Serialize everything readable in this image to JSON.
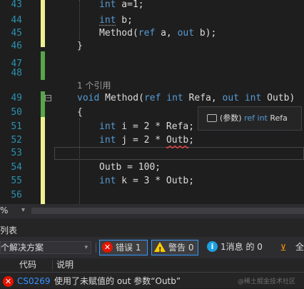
{
  "editor": {
    "lines": [
      {
        "num": "43"
      },
      {
        "num": "44"
      },
      {
        "num": "45"
      },
      {
        "num": "46"
      },
      {
        "num": "47"
      },
      {
        "num": "48"
      },
      {
        "num": "49"
      },
      {
        "num": "50"
      },
      {
        "num": "51"
      },
      {
        "num": "52"
      },
      {
        "num": "53"
      },
      {
        "num": "54"
      },
      {
        "num": "55"
      },
      {
        "num": "56"
      }
    ],
    "code": {
      "l43_kw": "int",
      "l43_rest": " a=1;",
      "l44_kw": "int",
      "l44_rest": " b;",
      "l45_a": "Method(",
      "l45_ref": "ref",
      "l45_b": " a, ",
      "l45_out": "out",
      "l45_c": " b);",
      "l46": "}",
      "l49_void": "void",
      "l49_a": " Method(",
      "l49_ref": "ref",
      "l49_int1": "int",
      "l49_b": " Refa, ",
      "l49_out": "out",
      "l49_int2": "int",
      "l49_c": " Outb)",
      "l50": "{",
      "l51_kw": "int",
      "l51_rest": " i = 2 * Refa;",
      "l52_kw": "int",
      "l52_rest": " j = 2 * ",
      "l52_err": "Outb",
      "l52_end": ";",
      "l54": "Outb = 100;",
      "l55_kw": "int",
      "l55_rest": " k = 3 * Outb;"
    },
    "codelens": "1 个引用",
    "collapse_glyph": "−"
  },
  "tooltip": {
    "prefix": "(参数)",
    "kw_ref": "ref",
    "kw_int": "int",
    "name": "Refa"
  },
  "statusbar": {
    "zoom": "%",
    "zoom_arrow": "▾"
  },
  "error_list": {
    "title": "列表",
    "scope": "个解决方案",
    "scope_arrow": "▾",
    "errors_label": "错误 1",
    "warnings_label": "警告 0",
    "messages_label": "1消息 的 0",
    "error_glyph": "✕",
    "info_glyph": "i",
    "warn_glyph": "!",
    "filter_glyph": "⊻",
    "extra_glyph": "全",
    "columns": {
      "code": "代码",
      "description": "说明"
    },
    "rows": [
      {
        "code": "CS0269",
        "description": "使用了未赋值的 out 参数“Outb”"
      }
    ],
    "watermark": "@稀土掘金技术社区"
  },
  "colors": {
    "keyword": "#569cd6",
    "line_number": "#2b91af",
    "error": "#e51400",
    "accent": "#3399ff"
  }
}
